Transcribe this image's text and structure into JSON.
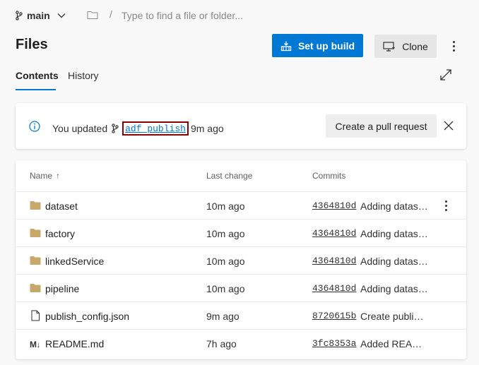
{
  "path_bar": {
    "branch": "main",
    "separator": "/",
    "search_placeholder": "Type to find a file or folder..."
  },
  "header": {
    "title": "Files",
    "setup_build_label": "Set up build",
    "clone_label": "Clone"
  },
  "tabs": [
    {
      "label": "Contents",
      "active": true
    },
    {
      "label": "History",
      "active": false
    }
  ],
  "banner": {
    "prefix": "You updated",
    "branch": "adf_publish",
    "suffix": "9m ago",
    "action_label": "Create a pull request"
  },
  "table": {
    "columns": {
      "name": "Name",
      "last_change": "Last change",
      "commits": "Commits"
    },
    "sort_indicator": "↑",
    "rows": [
      {
        "type": "folder",
        "name": "dataset",
        "last_change": "10m ago",
        "commit": "4364810d",
        "message": "Adding datasets"
      },
      {
        "type": "folder",
        "name": "factory",
        "last_change": "10m ago",
        "commit": "4364810d",
        "message": "Adding datasets"
      },
      {
        "type": "folder",
        "name": "linkedService",
        "last_change": "10m ago",
        "commit": "4364810d",
        "message": "Adding datasets"
      },
      {
        "type": "folder",
        "name": "pipeline",
        "last_change": "10m ago",
        "commit": "4364810d",
        "message": "Adding datasets"
      },
      {
        "type": "file",
        "name": "publish_config.json",
        "last_change": "9m ago",
        "commit": "8720615b",
        "message": "Create publish config"
      },
      {
        "type": "markdown",
        "name": "README.md",
        "last_change": "7h ago",
        "commit": "3fc8353a",
        "message": "Added README"
      }
    ],
    "md_icon_text": "M↓"
  },
  "colors": {
    "accent": "#0078d4",
    "highlight_border": "#8b0000",
    "folder": "#c8a86a"
  }
}
